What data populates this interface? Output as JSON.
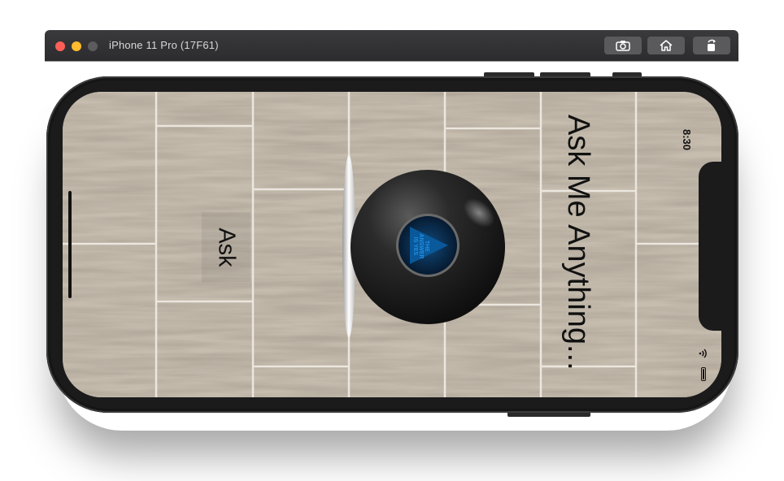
{
  "window": {
    "title": "iPhone 11 Pro (17F61)",
    "toolbar": [
      {
        "name": "screenshot",
        "icon": "camera-icon"
      },
      {
        "name": "home",
        "icon": "home-icon"
      },
      {
        "name": "rotate",
        "icon": "rotate-icon"
      }
    ]
  },
  "status_bar": {
    "time": "8:30",
    "icons": [
      "wifi-icon",
      "battery-icon"
    ]
  },
  "app": {
    "headline": "Ask Me Anything...",
    "ask_button_label": "Ask",
    "ball_answer_lines": [
      "THE",
      "ANSWER",
      "IS YES"
    ]
  },
  "colors": {
    "answer_text": "#1f8fe0",
    "ball": "#1c1c1c",
    "ball_window": "#0a4b86",
    "floor": "#c4bbad"
  }
}
